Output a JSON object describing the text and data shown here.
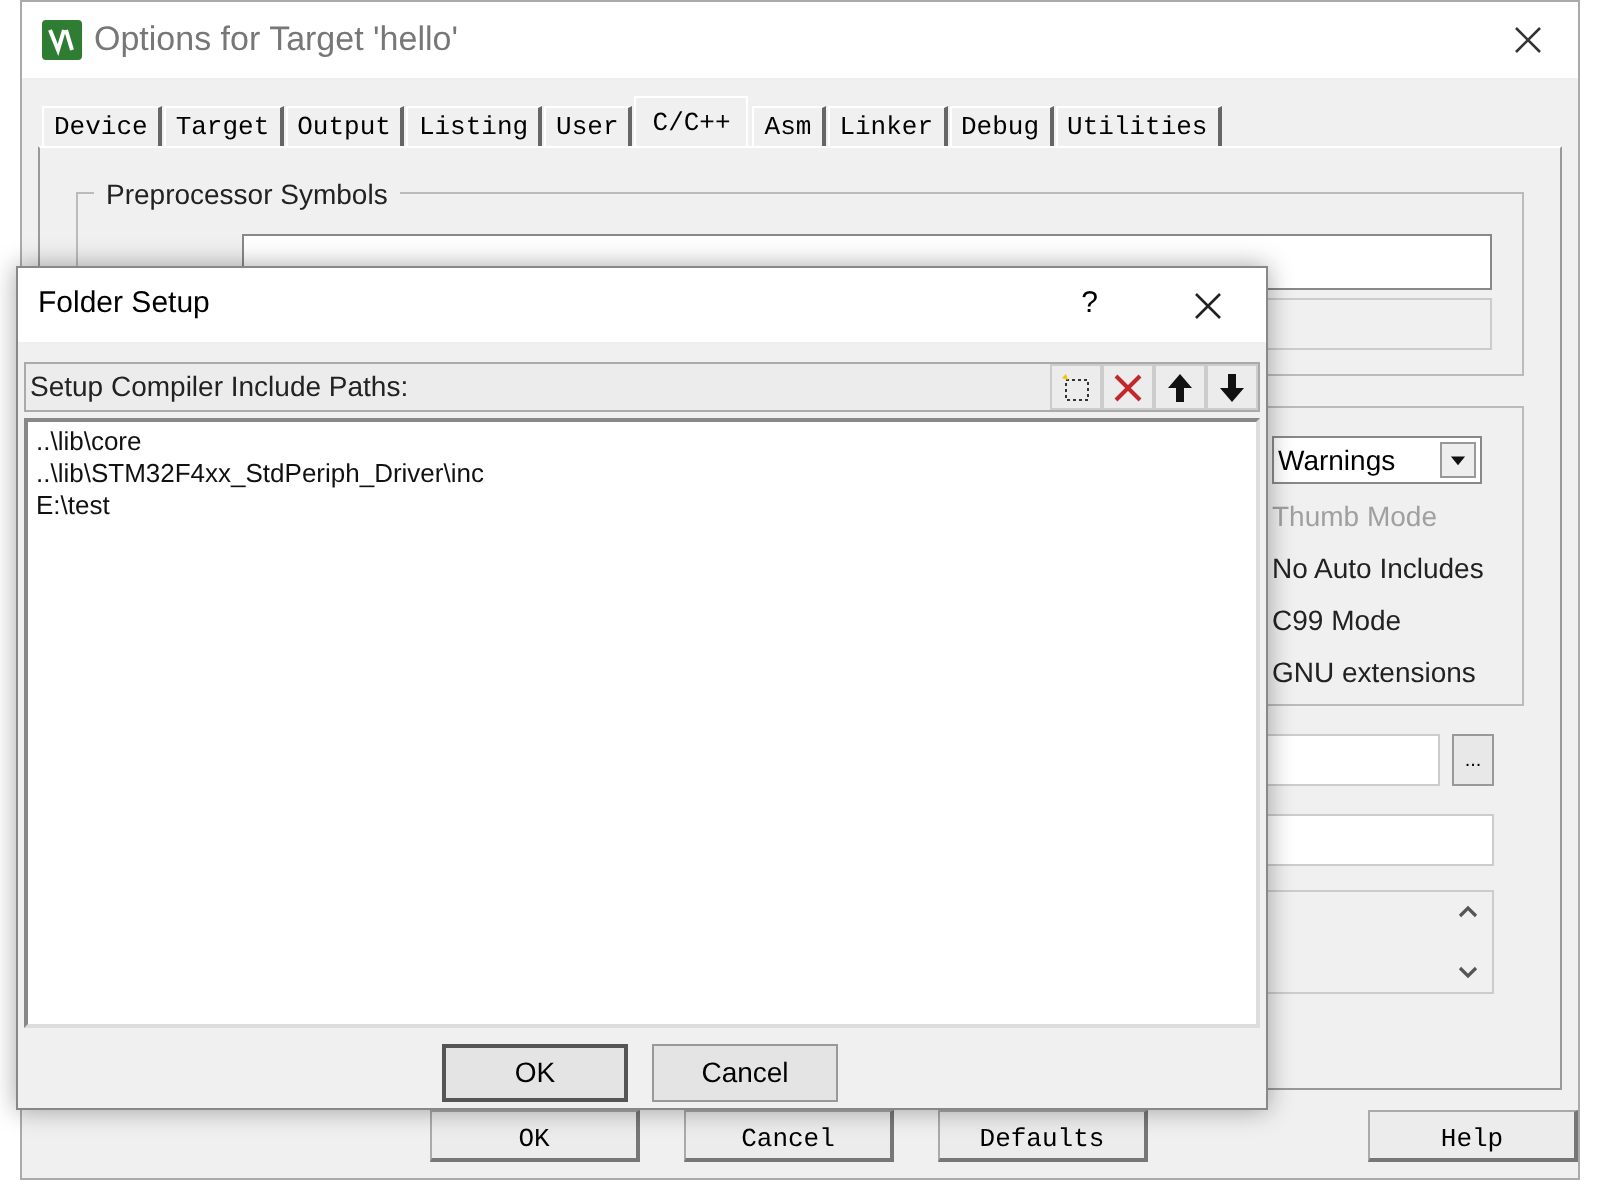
{
  "window": {
    "title": "Options for Target 'hello'"
  },
  "tabs": [
    {
      "label": "Device",
      "selected": false
    },
    {
      "label": "Target",
      "selected": false
    },
    {
      "label": "Output",
      "selected": false
    },
    {
      "label": "Listing",
      "selected": false
    },
    {
      "label": "User",
      "selected": false
    },
    {
      "label": "C/C++",
      "selected": true
    },
    {
      "label": "Asm",
      "selected": false
    },
    {
      "label": "Linker",
      "selected": false
    },
    {
      "label": "Debug",
      "selected": false
    },
    {
      "label": "Utilities",
      "selected": false
    }
  ],
  "preprocessor_group": {
    "title": "Preprocessor Symbols"
  },
  "warnings_dropdown": {
    "value": "Warnings"
  },
  "options": [
    {
      "label": "Thumb Mode",
      "disabled": true
    },
    {
      "label": "No Auto Includes",
      "disabled": false
    },
    {
      "label": "C99 Mode",
      "disabled": false
    },
    {
      "label": "GNU extensions",
      "disabled": false
    }
  ],
  "browse_button": "...",
  "buttons": [
    "OK",
    "Cancel",
    "Defaults",
    "Help"
  ],
  "folder_setup": {
    "title": "Folder Setup",
    "help": "?",
    "list_label": "Setup Compiler Include Paths:",
    "paths": [
      "..\\lib\\core",
      "..\\lib\\STM32F4xx_StdPeriph_Driver\\inc",
      "E:\\test"
    ],
    "buttons": [
      "OK",
      "Cancel"
    ]
  }
}
